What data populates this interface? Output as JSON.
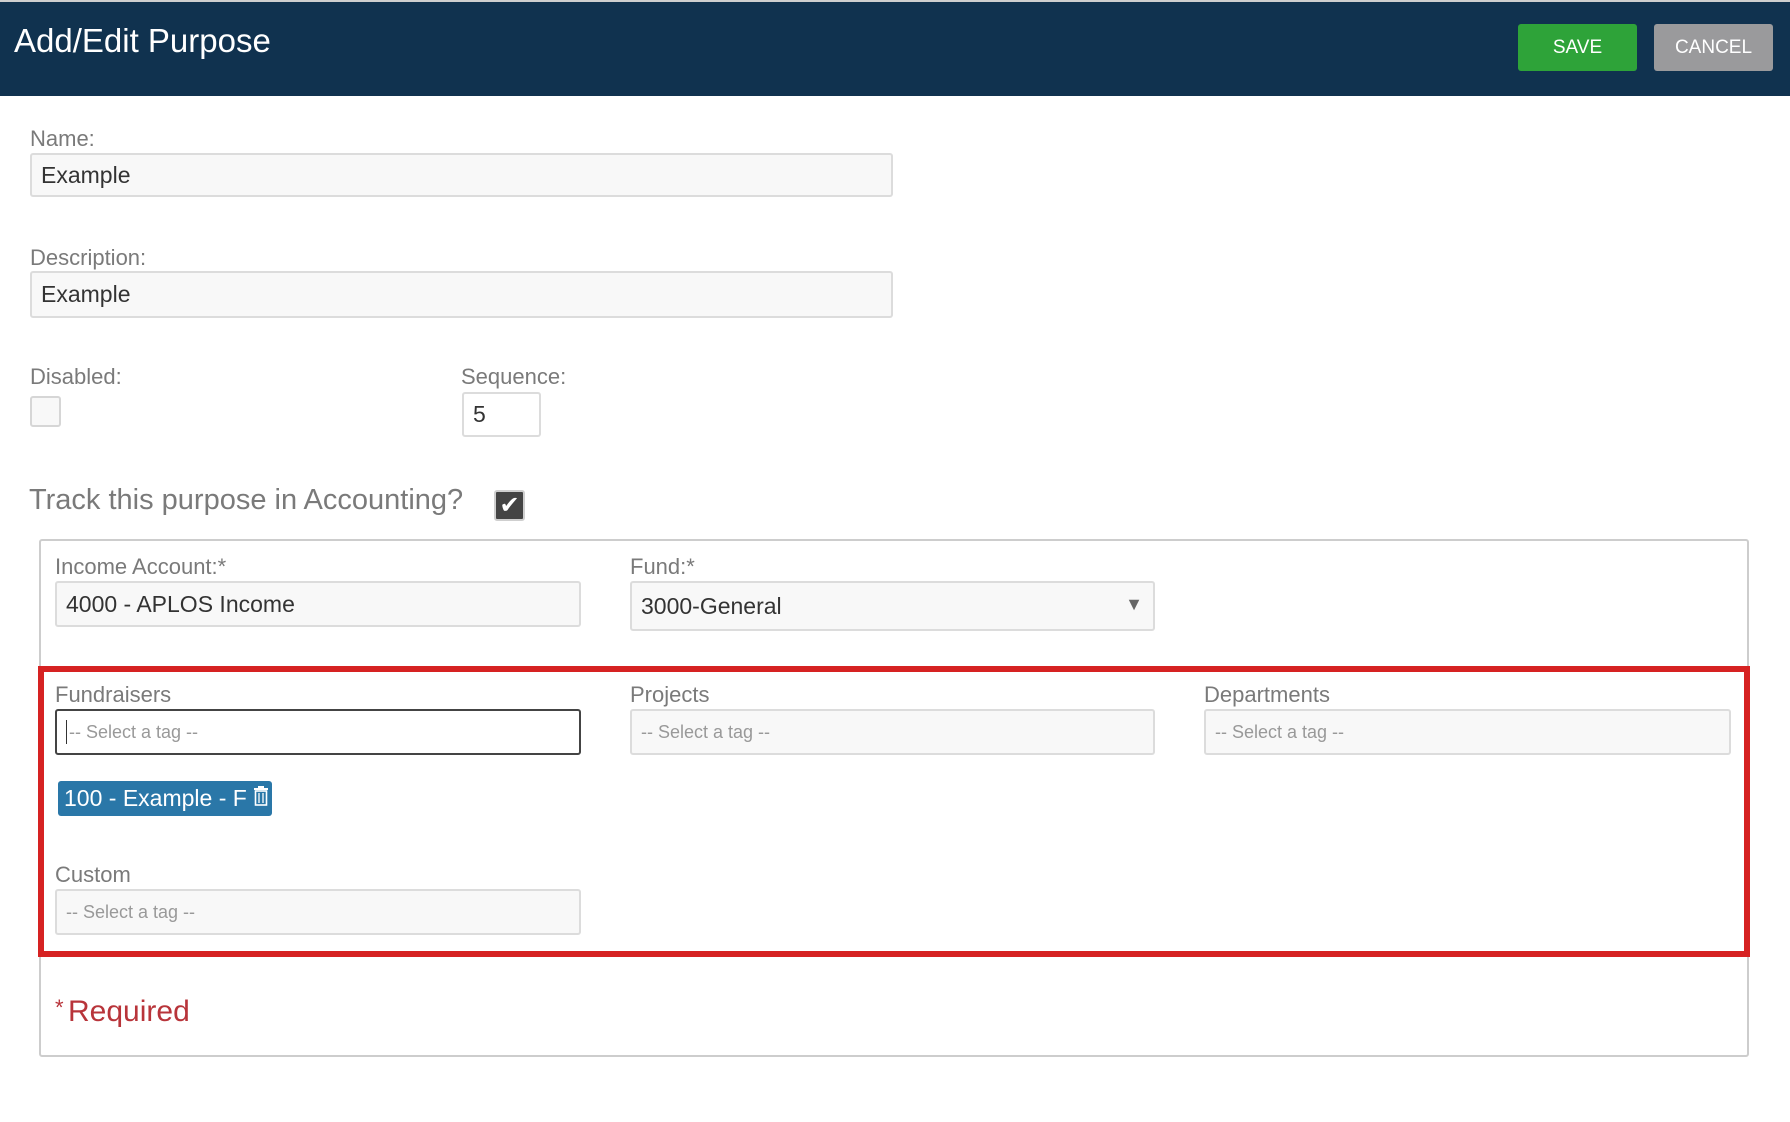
{
  "header": {
    "title": "Add/Edit Purpose",
    "save_label": "SAVE",
    "cancel_label": "CANCEL"
  },
  "form": {
    "name_label": "Name:",
    "name_value": "Example",
    "description_label": "Description:",
    "description_value": "Example",
    "disabled_label": "Disabled:",
    "disabled_checked": false,
    "sequence_label": "Sequence:",
    "sequence_value": "5",
    "track_label": "Track this purpose in Accounting?",
    "track_checked": true
  },
  "accounting": {
    "income_label": "Income Account:*",
    "income_value": "4000 - APLOS Income",
    "fund_label": "Fund:*",
    "fund_value": "3000-General",
    "fundraisers_label": "Fundraisers",
    "fundraisers_placeholder": "-- Select a tag --",
    "fundraisers_tags": [
      "100 - Example - F"
    ],
    "projects_label": "Projects",
    "projects_placeholder": "-- Select a tag --",
    "departments_label": "Departments",
    "departments_placeholder": "-- Select a tag --",
    "custom_label": "Custom",
    "custom_placeholder": "-- Select a tag --",
    "required_star": "*",
    "required_text": "Required"
  },
  "colors": {
    "header": "#10324f",
    "save": "#2ea339",
    "cancel": "#9a9a9c",
    "tag": "#2a77a8",
    "highlight": "#d62222",
    "required": "#b8343a"
  }
}
